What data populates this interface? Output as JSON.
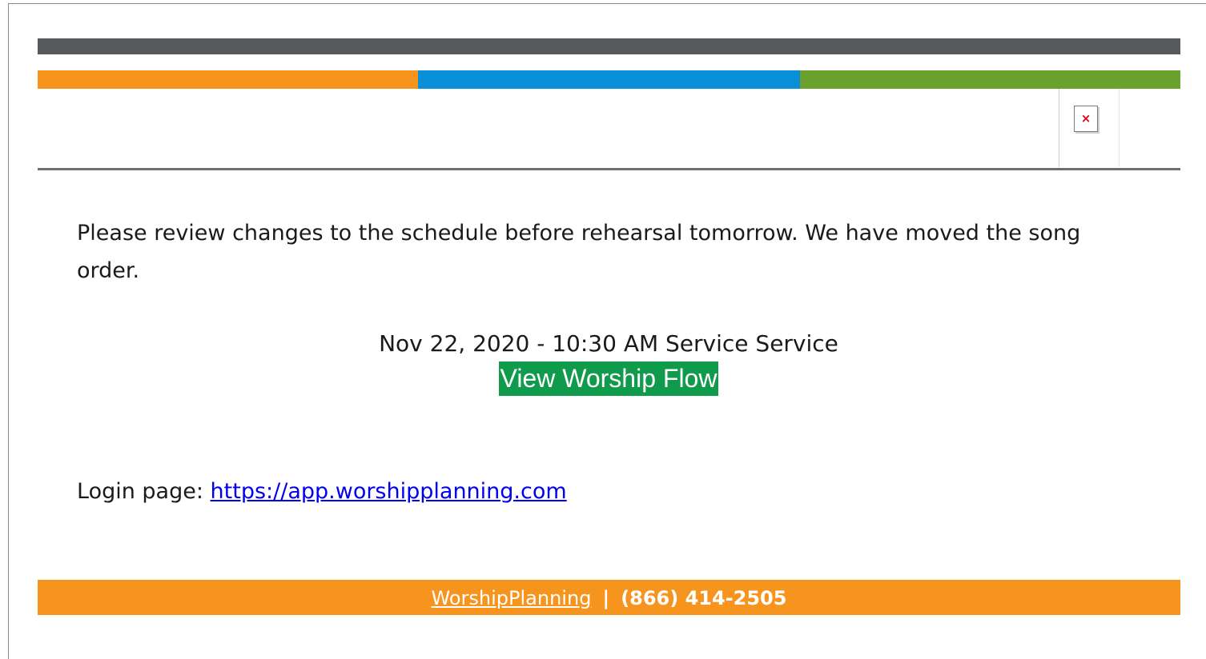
{
  "header": {
    "top_bar_color": "#58595b",
    "color_bar": [
      {
        "name": "orange",
        "color": "#f7941d"
      },
      {
        "name": "blue",
        "color": "#0b8ed8"
      },
      {
        "name": "green",
        "color": "#6aa22d"
      }
    ],
    "logo_icon": "broken-image-icon",
    "logo_glyph": "×"
  },
  "body": {
    "message": "Please review changes to the schedule before rehearsal tomorrow. We have moved the song order.",
    "event_line": "Nov 22, 2020 - 10:30 AM Service Service",
    "cta_label": "View Worship Flow",
    "cta_color": "#0f9a4c",
    "login_label": "Login page:",
    "login_url": "https://app.worshipplanning.com"
  },
  "footer": {
    "background": "#f7941d",
    "brand_link": "WorshipPlanning",
    "separator": "|",
    "phone": "(866) 414-2505"
  }
}
